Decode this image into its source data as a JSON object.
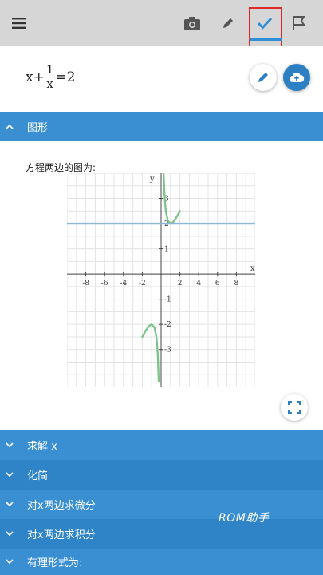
{
  "toolbar": {
    "menu_icon": "hamburger-icon",
    "camera_icon": "camera-icon",
    "pencil_icon": "pencil-icon",
    "check_icon": "check-icon",
    "flag_icon": "flag-icon",
    "highlight_color": "#e02828",
    "active_color": "#2f8fd6"
  },
  "equation": {
    "prefix": "x+",
    "fraction_numerator": "1",
    "fraction_denominator": "x",
    "suffix": "=2",
    "edit_icon": "pencil-icon",
    "upload_icon": "cloud-upload-icon"
  },
  "graph_section": {
    "title": "图形",
    "caption": "方程两边的图为:",
    "fullscreen_icon": "fullscreen-icon"
  },
  "chart_data": {
    "type": "line",
    "x_axis_label": "x",
    "y_axis_label": "y",
    "xlim": [
      -10,
      10
    ],
    "ylim": [
      -4.5,
      4
    ],
    "x_ticks": [
      "-8",
      "-6",
      "-4",
      "-2",
      "2",
      "4",
      "6",
      "8"
    ],
    "y_ticks": [
      "3",
      "2",
      "1",
      "-1",
      "-2",
      "-3"
    ],
    "grid": true,
    "series": [
      {
        "color": "#7dc48a",
        "expr": "x + 1/x",
        "points": [
          [
            0.27,
            3.97
          ],
          [
            0.35,
            3.21
          ],
          [
            0.5,
            2.5
          ],
          [
            0.7,
            2.13
          ],
          [
            1.0,
            2.0
          ],
          [
            1.3,
            2.07
          ],
          [
            1.6,
            2.23
          ],
          [
            2.0,
            2.5
          ]
        ]
      },
      {
        "color": "#7dc48a",
        "expr": "x + 1/x",
        "points": [
          [
            -2.0,
            -2.5
          ],
          [
            -1.6,
            -2.23
          ],
          [
            -1.3,
            -2.07
          ],
          [
            -1.0,
            -2.0
          ],
          [
            -0.7,
            -2.13
          ],
          [
            -0.5,
            -2.5
          ],
          [
            -0.35,
            -3.21
          ],
          [
            -0.25,
            -4.25
          ]
        ]
      },
      {
        "color": "#8ab8d6",
        "expr": "y = 2",
        "points": [
          [
            -10,
            2
          ],
          [
            10,
            2
          ]
        ]
      }
    ]
  },
  "sections": [
    {
      "title": "求解 x"
    },
    {
      "title": "化简"
    },
    {
      "title": "对x两边求微分"
    },
    {
      "title": "对x两边求积分"
    },
    {
      "title": "有理形式为:"
    }
  ],
  "watermark": "ROM助手"
}
